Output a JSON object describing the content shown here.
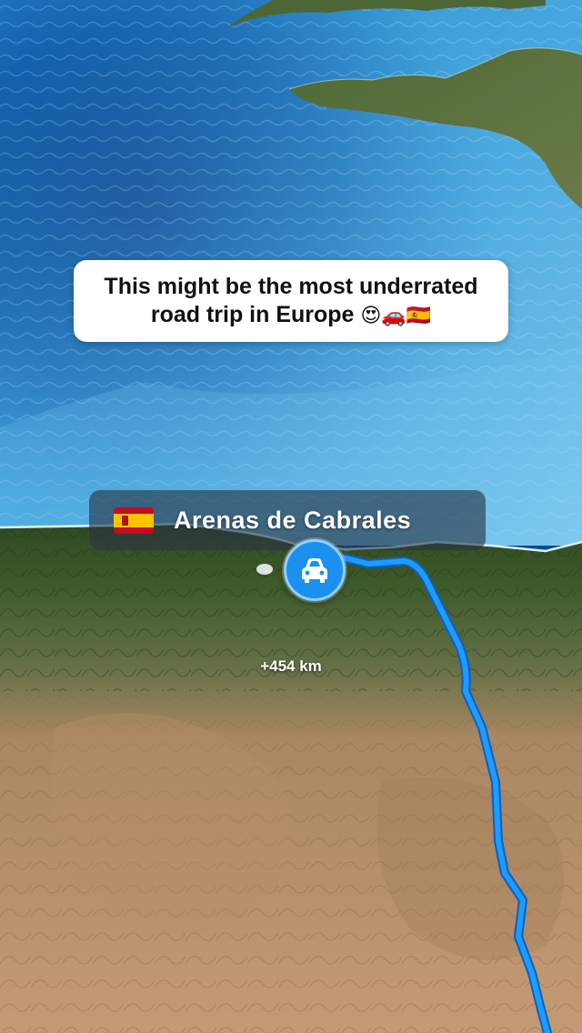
{
  "caption": {
    "line1": "This might be the most underrated",
    "line2": "road trip in Europe",
    "emoji": "😍🚗🇪🇸"
  },
  "location": {
    "flag_icon": "spain-flag-icon",
    "name": "Arenas de Cabrales"
  },
  "marker": {
    "icon": "car-icon"
  },
  "distance": {
    "label": "+454 km"
  },
  "colors": {
    "route": "#1e9bff",
    "coastline": "#dff1ff",
    "marker": "#1b90ef",
    "chip_bg": "rgba(40,52,66,0.62)",
    "caption_bg": "#ffffff"
  }
}
